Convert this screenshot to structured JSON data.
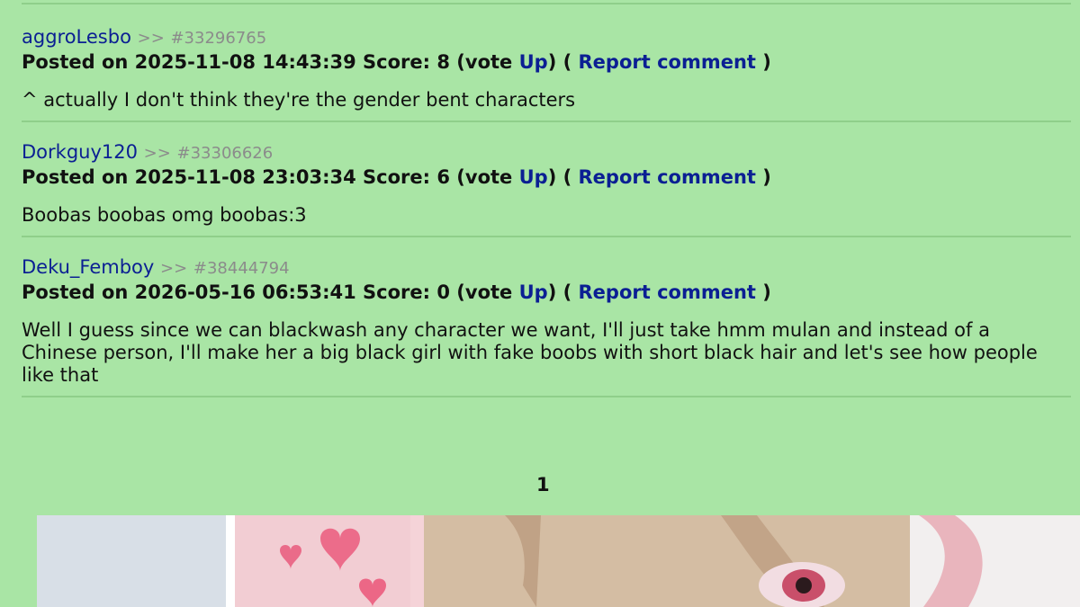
{
  "comments": [
    {
      "author": "aggroLesbo",
      "separator": ">>",
      "comment_id": "#33296765",
      "meta_prefix": "Posted on 2025-11-08 14:43:39 Score: 8 (vote ",
      "vote_label": "Up",
      "meta_mid": ") ( ",
      "report_label": "Report comment",
      "meta_suffix": " )",
      "text": "^ actually I don't think they're the gender bent characters"
    },
    {
      "author": "Dorkguy120",
      "separator": ">>",
      "comment_id": "#33306626",
      "meta_prefix": "Posted on 2025-11-08 23:03:34 Score: 6 (vote ",
      "vote_label": "Up",
      "meta_mid": ") ( ",
      "report_label": "Report comment",
      "meta_suffix": " )",
      "text": "Boobas boobas omg boobas:3"
    },
    {
      "author": "Deku_Femboy",
      "separator": ">>",
      "comment_id": "#38444794",
      "meta_prefix": "Posted on 2026-05-16 06:53:41 Score: 0 (vote ",
      "vote_label": "Up",
      "meta_mid": ") ( ",
      "report_label": "Report comment",
      "meta_suffix": " )",
      "text": "Well I guess since we can blackwash any character we want, I'll just take hmm mulan and instead of a Chinese person, I'll make her a big black girl with fake boobs with short black hair and let's see how people like that"
    }
  ],
  "pagination": {
    "current_page": "1"
  },
  "colors": {
    "background": "#a9e5a5",
    "link": "#0b1f93",
    "muted": "#8b8b8b"
  }
}
